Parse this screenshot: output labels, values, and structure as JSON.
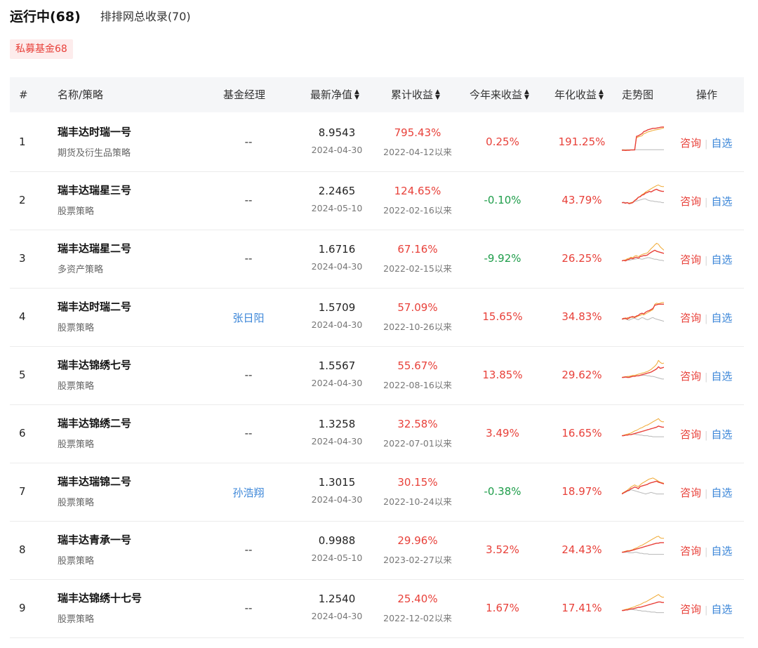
{
  "tabs": {
    "running": "运行中(68)",
    "paipai": "排排网总收录(70)"
  },
  "filter_pill": "私募基金68",
  "header": {
    "idx": "#",
    "name": "名称/策略",
    "manager": "基金经理",
    "nav": "最新净值",
    "cumulative": "累计收益",
    "ytd": "今年来收益",
    "annual": "年化收益",
    "trend": "走势图",
    "ops": "操作"
  },
  "sort_icon": "sort-updown-icon",
  "rows": [
    {
      "idx": "1",
      "name": "瑞丰达时瑞一号",
      "strategy": "期货及衍生品策略",
      "manager": "--",
      "manager_link": false,
      "nav": "8.9543",
      "nav_date": "2024-04-30",
      "cum": "795.43%",
      "since": "2022-04-12以来",
      "ytd": "0.25%",
      "ytd_color": "red",
      "annual": "191.25%",
      "consult": "咨询",
      "watch": "自选",
      "trend": {
        "fund": [
          0.08,
          0.08,
          0.07,
          0.08,
          0.08,
          0.09,
          0.09,
          0.09,
          0.6,
          0.62,
          0.66,
          0.7,
          0.78,
          0.8,
          0.84,
          0.86,
          0.88,
          0.9,
          0.9,
          0.91,
          0.92,
          0.94,
          0.95,
          0.95
        ],
        "bench": [
          0.1,
          0.1,
          0.1,
          0.1,
          0.1,
          0.1,
          0.1,
          0.1,
          0.1,
          0.1,
          0.1,
          0.1,
          0.1,
          0.1,
          0.1,
          0.1,
          0.1,
          0.1,
          0.1,
          0.1,
          0.1,
          0.1,
          0.1,
          0.1
        ],
        "ref": [
          0.09,
          0.09,
          0.09,
          0.09,
          0.09,
          0.09,
          0.09,
          0.1,
          0.55,
          0.58,
          0.6,
          0.62,
          0.7,
          0.72,
          0.76,
          0.78,
          0.8,
          0.82,
          0.84,
          0.85,
          0.86,
          0.88,
          0.9,
          0.92
        ]
      }
    },
    {
      "idx": "2",
      "name": "瑞丰达瑞星三号",
      "strategy": "股票策略",
      "manager": "--",
      "manager_link": false,
      "nav": "2.2465",
      "nav_date": "2024-05-10",
      "cum": "124.65%",
      "since": "2022-02-16以来",
      "ytd": "-0.10%",
      "ytd_color": "green",
      "annual": "43.79%",
      "consult": "咨询",
      "watch": "自选",
      "trend": {
        "fund": [
          0.3,
          0.3,
          0.28,
          0.3,
          0.26,
          0.28,
          0.3,
          0.38,
          0.42,
          0.5,
          0.52,
          0.58,
          0.6,
          0.66,
          0.68,
          0.72,
          0.7,
          0.74,
          0.78,
          0.8,
          0.76,
          0.74,
          0.72,
          0.72
        ],
        "bench": [
          0.3,
          0.32,
          0.3,
          0.3,
          0.28,
          0.3,
          0.32,
          0.34,
          0.36,
          0.38,
          0.4,
          0.42,
          0.44,
          0.44,
          0.4,
          0.38,
          0.36,
          0.36,
          0.34,
          0.34,
          0.32,
          0.32,
          0.3,
          0.3
        ],
        "ref": [
          0.3,
          0.3,
          0.28,
          0.3,
          0.28,
          0.3,
          0.32,
          0.38,
          0.44,
          0.5,
          0.54,
          0.6,
          0.64,
          0.7,
          0.74,
          0.78,
          0.82,
          0.86,
          0.9,
          0.94,
          0.96,
          0.92,
          0.9,
          0.9
        ]
      }
    },
    {
      "idx": "3",
      "name": "瑞丰达瑞星二号",
      "strategy": "多资产策略",
      "manager": "--",
      "manager_link": false,
      "nav": "1.6716",
      "nav_date": "2024-04-30",
      "cum": "67.16%",
      "since": "2022-02-15以来",
      "ytd": "-9.92%",
      "ytd_color": "green",
      "annual": "26.25%",
      "consult": "咨询",
      "watch": "自选",
      "trend": {
        "fund": [
          0.3,
          0.32,
          0.3,
          0.34,
          0.36,
          0.4,
          0.38,
          0.42,
          0.44,
          0.4,
          0.46,
          0.48,
          0.5,
          0.5,
          0.52,
          0.58,
          0.62,
          0.66,
          0.7,
          0.66,
          0.64,
          0.62,
          0.6,
          0.58
        ],
        "bench": [
          0.3,
          0.32,
          0.34,
          0.34,
          0.32,
          0.34,
          0.36,
          0.36,
          0.38,
          0.4,
          0.38,
          0.36,
          0.38,
          0.4,
          0.42,
          0.42,
          0.4,
          0.38,
          0.36,
          0.36,
          0.34,
          0.32,
          0.32,
          0.3
        ],
        "ref": [
          0.3,
          0.32,
          0.34,
          0.38,
          0.4,
          0.44,
          0.42,
          0.48,
          0.5,
          0.46,
          0.5,
          0.54,
          0.56,
          0.58,
          0.6,
          0.68,
          0.76,
          0.82,
          0.9,
          0.96,
          0.92,
          0.82,
          0.76,
          0.7
        ]
      }
    },
    {
      "idx": "4",
      "name": "瑞丰达时瑞二号",
      "strategy": "股票策略",
      "manager": "张日阳",
      "manager_link": true,
      "nav": "1.5709",
      "nav_date": "2024-04-30",
      "cum": "57.09%",
      "since": "2022-10-26以来",
      "ytd": "15.65%",
      "ytd_color": "red",
      "annual": "34.83%",
      "consult": "咨询",
      "watch": "自选",
      "trend": {
        "fund": [
          0.3,
          0.32,
          0.34,
          0.3,
          0.36,
          0.38,
          0.4,
          0.36,
          0.42,
          0.44,
          0.5,
          0.52,
          0.5,
          0.56,
          0.6,
          0.62,
          0.66,
          0.7,
          0.82,
          0.84,
          0.86,
          0.86,
          0.86,
          0.86
        ],
        "bench": [
          0.3,
          0.3,
          0.32,
          0.28,
          0.26,
          0.3,
          0.32,
          0.34,
          0.3,
          0.28,
          0.32,
          0.36,
          0.34,
          0.3,
          0.28,
          0.3,
          0.34,
          0.36,
          0.32,
          0.3,
          0.28,
          0.26,
          0.24,
          0.22
        ],
        "ref": [
          0.3,
          0.34,
          0.3,
          0.36,
          0.32,
          0.38,
          0.36,
          0.4,
          0.38,
          0.42,
          0.44,
          0.48,
          0.46,
          0.5,
          0.54,
          0.58,
          0.62,
          0.66,
          0.86,
          0.9,
          0.88,
          0.9,
          0.92,
          0.92
        ]
      }
    },
    {
      "idx": "5",
      "name": "瑞丰达锦绣七号",
      "strategy": "股票策略",
      "manager": "--",
      "manager_link": false,
      "nav": "1.5567",
      "nav_date": "2024-04-30",
      "cum": "55.67%",
      "since": "2022-08-16以来",
      "ytd": "13.85%",
      "ytd_color": "red",
      "annual": "29.62%",
      "consult": "咨询",
      "watch": "自选",
      "trend": {
        "fund": [
          0.3,
          0.3,
          0.32,
          0.3,
          0.3,
          0.32,
          0.34,
          0.34,
          0.36,
          0.36,
          0.38,
          0.4,
          0.42,
          0.44,
          0.46,
          0.48,
          0.5,
          0.54,
          0.58,
          0.62,
          0.7,
          0.64,
          0.66,
          0.68
        ],
        "bench": [
          0.3,
          0.3,
          0.3,
          0.32,
          0.32,
          0.34,
          0.34,
          0.34,
          0.36,
          0.36,
          0.38,
          0.38,
          0.38,
          0.38,
          0.36,
          0.36,
          0.34,
          0.34,
          0.32,
          0.3,
          0.28,
          0.26,
          0.24,
          0.24
        ],
        "ref": [
          0.3,
          0.32,
          0.32,
          0.34,
          0.34,
          0.36,
          0.38,
          0.38,
          0.4,
          0.42,
          0.44,
          0.46,
          0.48,
          0.5,
          0.52,
          0.56,
          0.6,
          0.66,
          0.72,
          0.8,
          0.94,
          0.86,
          0.82,
          0.84
        ]
      }
    },
    {
      "idx": "6",
      "name": "瑞丰达锦绣二号",
      "strategy": "股票策略",
      "manager": "--",
      "manager_link": false,
      "nav": "1.3258",
      "nav_date": "2024-04-30",
      "cum": "32.58%",
      "since": "2022-07-01以来",
      "ytd": "3.49%",
      "ytd_color": "red",
      "annual": "16.65%",
      "consult": "咨询",
      "watch": "自选",
      "trend": {
        "fund": [
          0.3,
          0.3,
          0.32,
          0.32,
          0.34,
          0.34,
          0.36,
          0.38,
          0.4,
          0.42,
          0.44,
          0.46,
          0.48,
          0.5,
          0.52,
          0.54,
          0.56,
          0.58,
          0.6,
          0.62,
          0.66,
          0.64,
          0.62,
          0.62
        ],
        "bench": [
          0.3,
          0.3,
          0.32,
          0.32,
          0.34,
          0.34,
          0.36,
          0.36,
          0.34,
          0.34,
          0.32,
          0.32,
          0.3,
          0.3,
          0.3,
          0.28,
          0.28,
          0.26,
          0.26,
          0.26,
          0.26,
          0.26,
          0.26,
          0.26
        ],
        "ref": [
          0.3,
          0.32,
          0.34,
          0.36,
          0.38,
          0.4,
          0.44,
          0.48,
          0.5,
          0.54,
          0.58,
          0.6,
          0.64,
          0.68,
          0.7,
          0.74,
          0.78,
          0.82,
          0.86,
          0.9,
          0.94,
          0.86,
          0.82,
          0.82
        ]
      }
    },
    {
      "idx": "7",
      "name": "瑞丰达瑞锦二号",
      "strategy": "股票策略",
      "manager": "孙浩翔",
      "manager_link": true,
      "nav": "1.3015",
      "nav_date": "2024-04-30",
      "cum": "30.15%",
      "since": "2022-10-24以来",
      "ytd": "-0.38%",
      "ytd_color": "green",
      "annual": "18.97%",
      "consult": "咨询",
      "watch": "自选",
      "trend": {
        "fund": [
          0.3,
          0.34,
          0.38,
          0.42,
          0.44,
          0.5,
          0.52,
          0.56,
          0.54,
          0.5,
          0.58,
          0.6,
          0.62,
          0.64,
          0.66,
          0.7,
          0.72,
          0.74,
          0.76,
          0.78,
          0.74,
          0.72,
          0.7,
          0.68
        ],
        "bench": [
          0.3,
          0.34,
          0.36,
          0.4,
          0.42,
          0.46,
          0.44,
          0.42,
          0.4,
          0.38,
          0.36,
          0.34,
          0.32,
          0.3,
          0.32,
          0.34,
          0.36,
          0.34,
          0.32,
          0.3,
          0.3,
          0.3,
          0.3,
          0.3
        ],
        "ref": [
          0.32,
          0.36,
          0.4,
          0.44,
          0.5,
          0.56,
          0.6,
          0.64,
          0.6,
          0.58,
          0.64,
          0.7,
          0.74,
          0.78,
          0.82,
          0.86,
          0.88,
          0.9,
          0.86,
          0.82,
          0.78,
          0.74,
          0.72,
          0.7
        ]
      }
    },
    {
      "idx": "8",
      "name": "瑞丰达青承一号",
      "strategy": "股票策略",
      "manager": "--",
      "manager_link": false,
      "nav": "0.9988",
      "nav_date": "2024-05-10",
      "cum": "29.96%",
      "since": "2023-02-27以来",
      "ytd": "3.52%",
      "ytd_color": "red",
      "annual": "24.43%",
      "consult": "咨询",
      "watch": "自选",
      "trend": {
        "fund": [
          0.3,
          0.3,
          0.32,
          0.34,
          0.34,
          0.36,
          0.38,
          0.4,
          0.42,
          0.44,
          0.46,
          0.48,
          0.5,
          0.52,
          0.54,
          0.56,
          0.58,
          0.6,
          0.62,
          0.64,
          0.64,
          0.66,
          0.66,
          0.66
        ],
        "bench": [
          0.3,
          0.3,
          0.3,
          0.3,
          0.28,
          0.28,
          0.28,
          0.3,
          0.3,
          0.28,
          0.26,
          0.26,
          0.24,
          0.24,
          0.24,
          0.22,
          0.22,
          0.22,
          0.22,
          0.22,
          0.22,
          0.22,
          0.22,
          0.22
        ],
        "ref": [
          0.3,
          0.32,
          0.34,
          0.36,
          0.36,
          0.38,
          0.4,
          0.44,
          0.46,
          0.5,
          0.54,
          0.56,
          0.6,
          0.64,
          0.68,
          0.72,
          0.76,
          0.8,
          0.84,
          0.88,
          0.9,
          0.84,
          0.82,
          0.82
        ]
      }
    },
    {
      "idx": "9",
      "name": "瑞丰达锦绣十七号",
      "strategy": "股票策略",
      "manager": "--",
      "manager_link": false,
      "nav": "1.2540",
      "nav_date": "2024-04-30",
      "cum": "25.40%",
      "since": "2022-12-02以来",
      "ytd": "1.67%",
      "ytd_color": "red",
      "annual": "17.41%",
      "consult": "咨询",
      "watch": "自选",
      "trend": {
        "fund": [
          0.3,
          0.3,
          0.32,
          0.32,
          0.34,
          0.36,
          0.36,
          0.38,
          0.4,
          0.42,
          0.42,
          0.44,
          0.46,
          0.48,
          0.5,
          0.52,
          0.54,
          0.56,
          0.58,
          0.6,
          0.62,
          0.62,
          0.6,
          0.6
        ],
        "bench": [
          0.3,
          0.3,
          0.32,
          0.32,
          0.34,
          0.34,
          0.34,
          0.32,
          0.32,
          0.3,
          0.3,
          0.28,
          0.28,
          0.28,
          0.26,
          0.26,
          0.24,
          0.24,
          0.24,
          0.22,
          0.22,
          0.22,
          0.22,
          0.22
        ],
        "ref": [
          0.3,
          0.32,
          0.34,
          0.36,
          0.38,
          0.4,
          0.42,
          0.44,
          0.48,
          0.5,
          0.52,
          0.56,
          0.6,
          0.62,
          0.66,
          0.7,
          0.74,
          0.78,
          0.82,
          0.86,
          0.9,
          0.84,
          0.8,
          0.8
        ]
      }
    }
  ],
  "colors": {
    "red": "#e8413a",
    "green": "#1e9d4a",
    "link": "#3b86d8",
    "trend_fund": "#e8413a",
    "trend_ref": "#f0a830",
    "trend_bench": "#b8b8b8"
  }
}
